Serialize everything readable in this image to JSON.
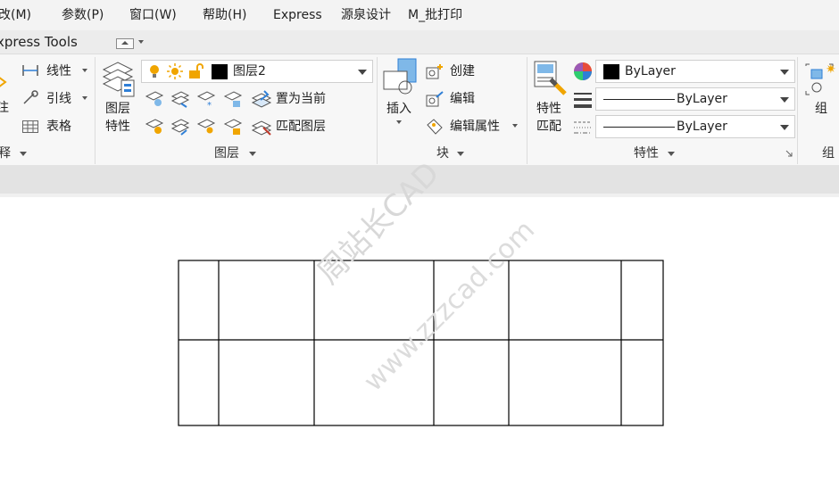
{
  "menubar": {
    "items": [
      "改(M)",
      "参数(P)",
      "窗口(W)",
      "帮助(H)",
      "Express",
      "源泉设计",
      "M_批打印"
    ]
  },
  "ribbon_tab": {
    "label": "xpress Tools"
  },
  "annotate": {
    "partial_label": "注",
    "linear_label": "线性",
    "leader_label": "引线",
    "table_label": "表格",
    "group_label": "释"
  },
  "layers": {
    "layer_props_line1": "图层",
    "layer_props_line2": "特性",
    "current_layer": "图层2",
    "set_current_label": "置为当前",
    "match_layer_label": "匹配图层",
    "group_label": "图层"
  },
  "block": {
    "insert_label": "插入",
    "create_label": "创建",
    "edit_label": "编辑",
    "edit_attr_label": "编辑属性",
    "group_label": "块"
  },
  "properties": {
    "match_line1": "特性",
    "match_line2": "匹配",
    "color_value": "ByLayer",
    "lineweight_value": "ByLayer",
    "linetype_value": "ByLayer",
    "group_label": "特性"
  },
  "groups": {
    "group_label": "组",
    "panel_label": "组"
  },
  "watermark": {
    "line1": "周站长CAD",
    "line2": "www.zzzcad.com"
  },
  "colors": {
    "accent": "#2f7fd6",
    "bulb": "#f0a500",
    "lock": "#f0a500"
  }
}
